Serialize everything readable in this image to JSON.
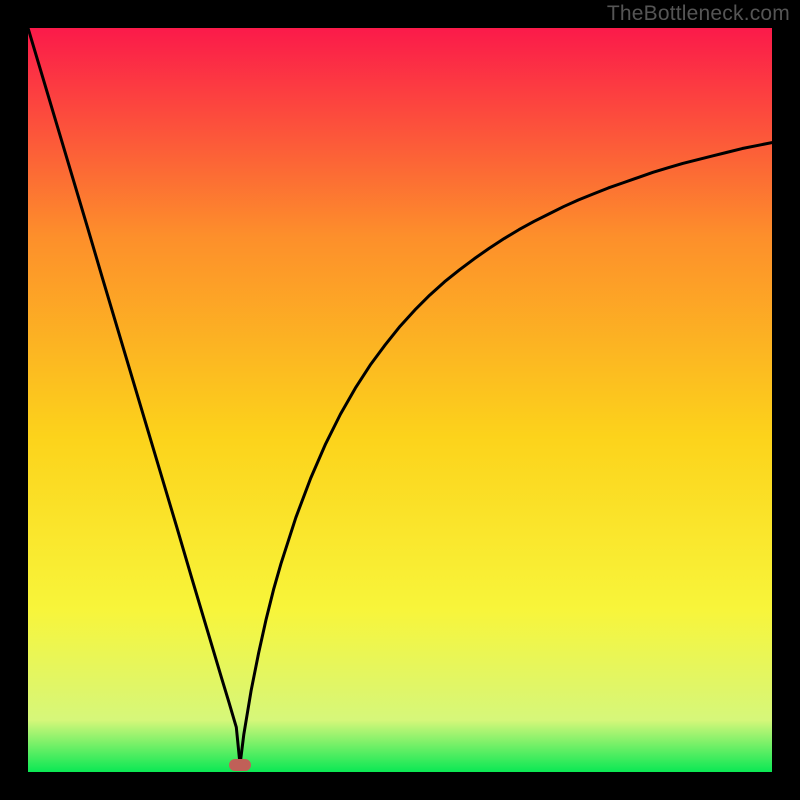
{
  "watermark": "TheBottleneck.com",
  "chart_data": {
    "type": "line",
    "title": "",
    "xlabel": "",
    "ylabel": "",
    "xlim": [
      0,
      100
    ],
    "ylim": [
      0,
      100
    ],
    "grid": false,
    "background_gradient": {
      "top": "#fb1a4a",
      "upper_mid": "#fd8f2b",
      "mid": "#fcd31b",
      "lower_mid": "#f8f53a",
      "near_bottom": "#d6f77a",
      "bottom": "#0ae854"
    },
    "curve_color": "#000000",
    "curve_width": 3,
    "marker": {
      "x": 28.5,
      "y": 1.0,
      "color": "#c06058",
      "shape": "pill"
    },
    "series": [
      {
        "name": "left-branch",
        "x": [
          -1,
          0,
          2,
          4,
          6,
          8,
          10,
          12,
          14,
          16,
          18,
          20,
          22,
          24,
          26,
          27,
          28,
          28.5
        ],
        "values": [
          103,
          100,
          93.3,
          86.6,
          79.9,
          73.2,
          66.4,
          59.7,
          53.0,
          46.3,
          39.6,
          32.9,
          26.1,
          19.4,
          12.7,
          9.4,
          6.0,
          1.0
        ]
      },
      {
        "name": "right-branch",
        "x": [
          28.5,
          29,
          30,
          31,
          32,
          33,
          34,
          36,
          38,
          40,
          42,
          44,
          46,
          48,
          50,
          52,
          54,
          56,
          58,
          60,
          62,
          64,
          66,
          68,
          70,
          72,
          74,
          76,
          78,
          80,
          82,
          84,
          86,
          88,
          90,
          92,
          94,
          96,
          98,
          100
        ],
        "values": [
          1.0,
          5.0,
          11.0,
          16.0,
          20.5,
          24.5,
          28.0,
          34.2,
          39.5,
          44.1,
          48.1,
          51.6,
          54.7,
          57.4,
          59.9,
          62.1,
          64.1,
          65.9,
          67.5,
          69.0,
          70.4,
          71.7,
          72.9,
          74.0,
          75.0,
          76.0,
          76.9,
          77.7,
          78.5,
          79.2,
          79.9,
          80.6,
          81.2,
          81.8,
          82.3,
          82.8,
          83.3,
          83.8,
          84.2,
          84.6
        ]
      }
    ]
  }
}
